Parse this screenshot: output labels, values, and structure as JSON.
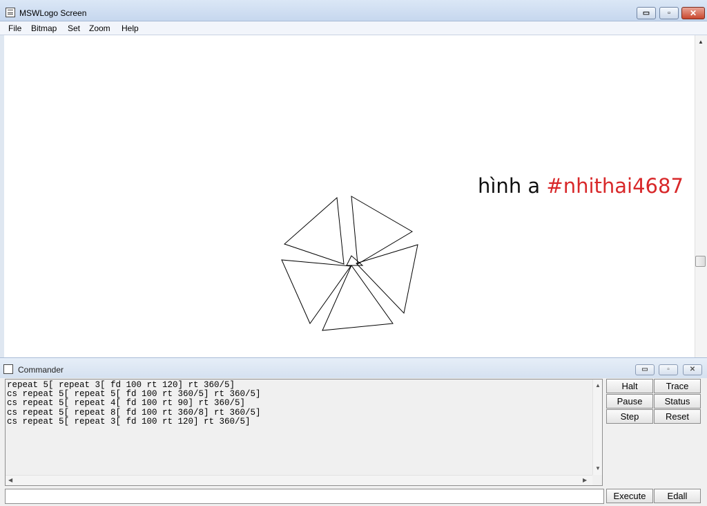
{
  "window": {
    "title": "MSWLogo Screen",
    "controls": {
      "minimize": "▭",
      "maximize": "▫",
      "close": "✕"
    }
  },
  "menu": [
    "File",
    "Bitmap",
    "Set",
    "Zoom",
    "Help"
  ],
  "canvas": {
    "caption_prefix": "hình a",
    "caption_hashtag": "#nhithai4687",
    "drawing": {
      "description_icon": "turtle-triangles-figure",
      "line_color": "#000000"
    }
  },
  "commander": {
    "title": "Commander",
    "history": [
      "repeat 5[ repeat 3[ fd 100 rt 120] rt 360/5]",
      "cs repeat 5[ repeat 5[ fd 100 rt 360/5] rt 360/5]",
      "cs repeat 5[ repeat 4[ fd 100 rt 90] rt 360/5]",
      "cs repeat 5[ repeat 8[ fd 100 rt 360/8] rt 360/5]",
      "cs repeat 5[ repeat 3[ fd 100 rt 120] rt 360/5]"
    ],
    "input_value": "",
    "buttons": {
      "halt": "Halt",
      "trace": "Trace",
      "pause": "Pause",
      "status": "Status",
      "step": "Step",
      "reset": "Reset",
      "execute": "Execute",
      "edall": "Edall"
    }
  },
  "colors": {
    "hashtag": "#d8282a",
    "title_bar": "#c6d7ee",
    "close_button": "#c9472e"
  }
}
